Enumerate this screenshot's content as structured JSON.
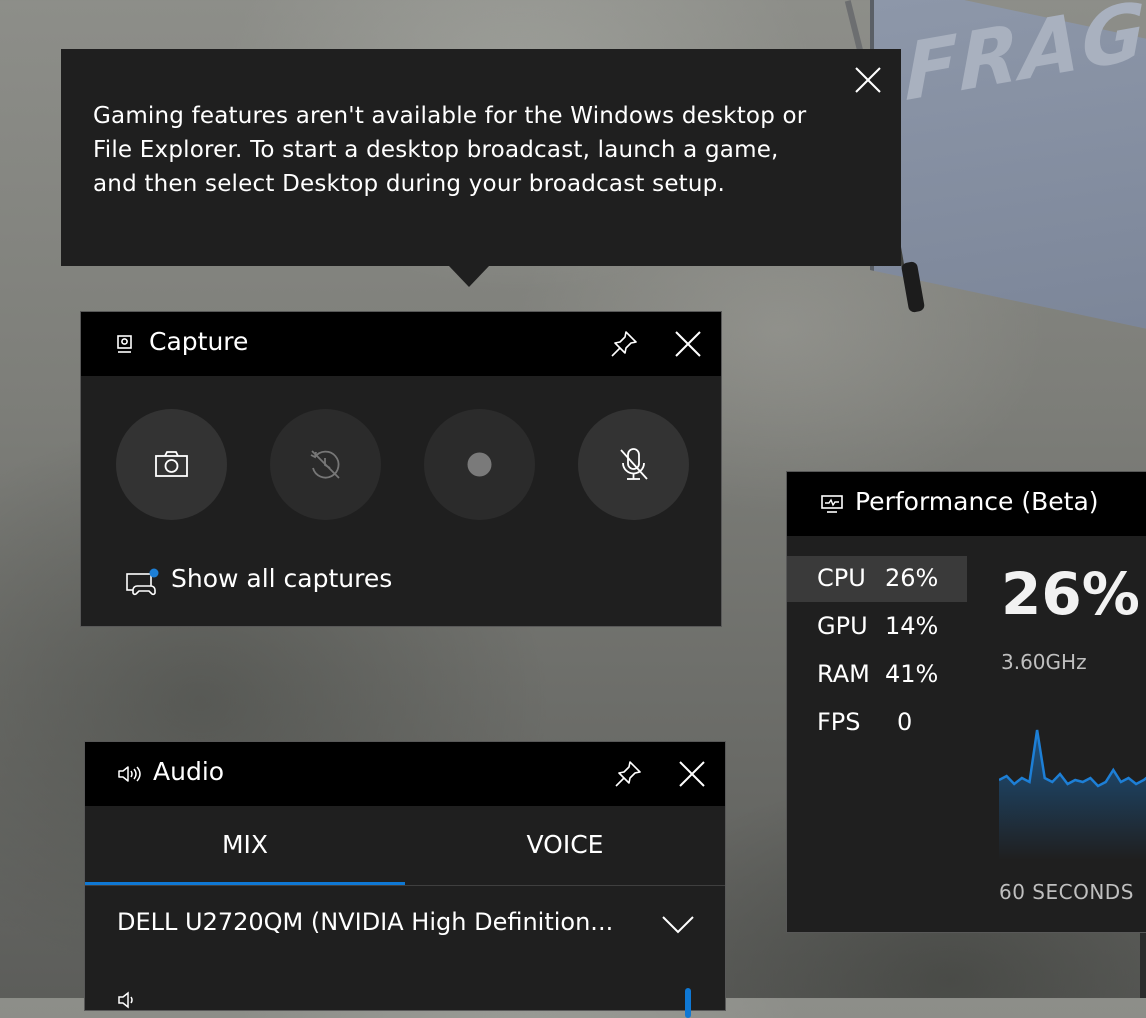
{
  "background": {
    "sign_text": "FRAGILE"
  },
  "tooltip": {
    "message": "Gaming features aren't available for the Windows desktop or\nFile Explorer. To start a desktop broadcast, launch a game,\nand then select Desktop during your broadcast setup.",
    "close_icon": "close-icon"
  },
  "capture": {
    "title": "Capture",
    "title_icon": "webcam-icon",
    "buttons": [
      {
        "name": "screenshot",
        "icon": "camera-icon"
      },
      {
        "name": "record-last-30s",
        "icon": "record-history-icon"
      },
      {
        "name": "start-recording",
        "icon": "record-dot-icon"
      },
      {
        "name": "mic-toggle",
        "icon": "mic-off-icon"
      }
    ],
    "show_all_label": "Show all captures"
  },
  "performance": {
    "title": "Performance (Beta)",
    "title_icon": "monitor-chart-icon",
    "metrics": [
      {
        "name": "CPU",
        "value": "26%",
        "selected": true
      },
      {
        "name": "GPU",
        "value": "14%",
        "selected": false
      },
      {
        "name": "RAM",
        "value": "41%",
        "selected": false
      },
      {
        "name": "FPS",
        "value": "0",
        "selected": false
      }
    ],
    "big_value": "26%",
    "frequency": "3.60GHz",
    "graph_label": "60 SECONDS",
    "graph_color": "#1d7fd6",
    "graph_points": [
      20,
      24,
      16,
      22,
      18,
      70,
      22,
      18,
      26,
      16,
      20,
      18,
      22,
      14,
      18,
      30,
      18,
      22,
      16,
      20,
      26,
      40
    ]
  },
  "audio": {
    "title": "Audio",
    "title_icon": "speaker-icon",
    "tabs": [
      {
        "label": "MIX",
        "active": true
      },
      {
        "label": "VOICE",
        "active": false
      }
    ],
    "device": "DELL U2720QM (NVIDIA High Definition...",
    "accent": "#0f78d4"
  }
}
